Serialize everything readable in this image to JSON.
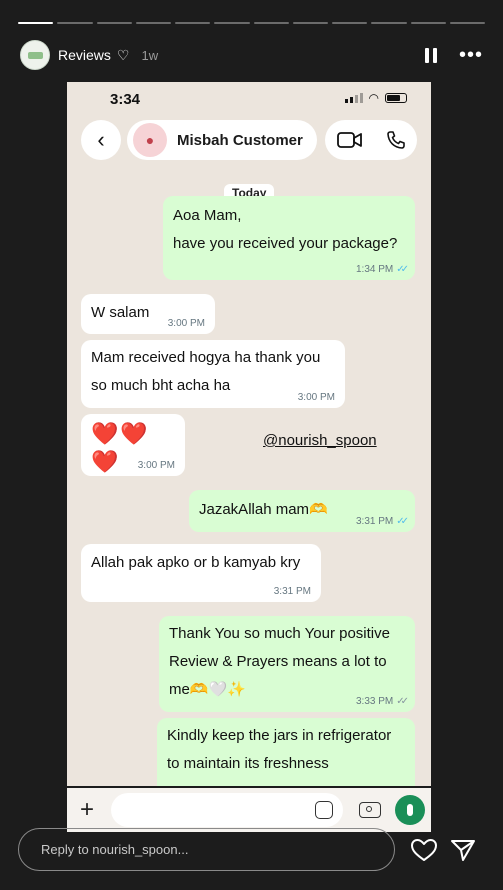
{
  "story": {
    "username": "Reviews",
    "age": "1w",
    "heart_icon": "heart-icon",
    "pause_icon": "pause-icon",
    "more_icon": "more-icon"
  },
  "phone": {
    "time": "3:34",
    "contact_name": "Misbah Customer",
    "date_chip": "Today"
  },
  "messages": [
    {
      "dir": "out",
      "line1": "Aoa Mam,",
      "line2": "have you received your package?",
      "time": "1:34 PM",
      "read": true
    },
    {
      "dir": "in",
      "text": "W salam",
      "time": "3:00 PM"
    },
    {
      "dir": "in",
      "line1": "Mam received hogya ha thank you",
      "line2": "so much bht acha ha",
      "time": "3:00 PM"
    },
    {
      "dir": "in",
      "text": "❤️❤️❤️",
      "time": "3:00 PM"
    },
    {
      "dir": "out",
      "text": "JazakAllah mam🫶",
      "time": "3:31 PM",
      "read": true
    },
    {
      "dir": "in",
      "text": "Allah pak apko or b kamyab kry",
      "time": "3:31 PM"
    },
    {
      "dir": "out",
      "line1": "Thank You so much Your positive",
      "line2": "Review & Prayers means a lot to",
      "line3": "me🫶🤍✨",
      "time": "3:33 PM",
      "read": false
    },
    {
      "dir": "out",
      "line1": "Kindly keep the jars in refrigerator",
      "line2": "to maintain its freshness"
    }
  ],
  "watermark": "@nourish_spoon",
  "reply": {
    "placeholder": "Reply to nourish_spoon..."
  },
  "colors": {
    "incoming": "#ffffff",
    "outgoing": "#d9fdd3",
    "wallpaper": "#ece5dd",
    "read_tick": "#53bdeb",
    "mic": "#1a8f58"
  }
}
